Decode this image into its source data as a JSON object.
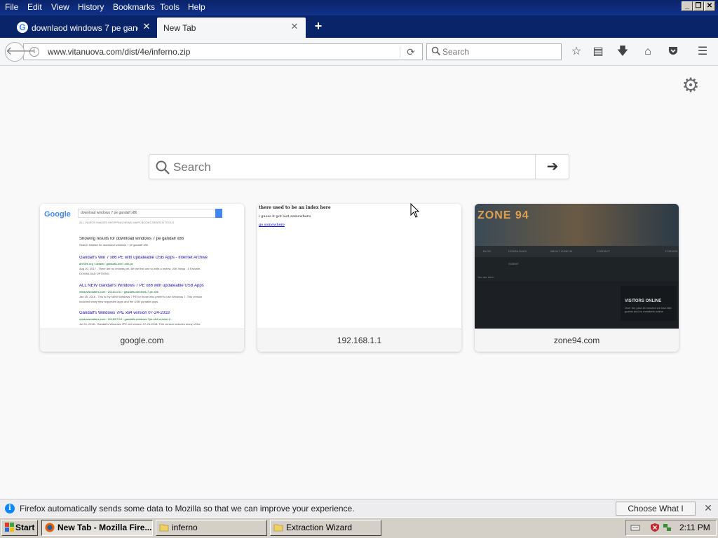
{
  "menubar": {
    "items": [
      "File",
      "Edit",
      "View",
      "History",
      "Bookmarks",
      "Tools",
      "Help"
    ]
  },
  "tabs": [
    {
      "title": "downlaod windows 7 pe gand...",
      "favicon": "google-g-icon",
      "active": false
    },
    {
      "title": "New Tab",
      "active": true
    }
  ],
  "navbar": {
    "url": "www.vitanuova.com/dist/4e/inferno.zip",
    "search_placeholder": "Search"
  },
  "newtab": {
    "search_placeholder": "Search",
    "tiles": [
      {
        "label": "google.com"
      },
      {
        "label": "192.168.1.1"
      },
      {
        "label": "zone94.com"
      }
    ]
  },
  "google_thumb": {
    "logo": "Google",
    "query": "download windows 7 pe gandalf x86",
    "tabs": "ALL    VIDEOS    IMAGES    SHOPPING    NEWS    MAPS    BOOKS    SEARCH TOOLS",
    "showing": "Showing results for download windows 7 pe gandalf x86",
    "search_instead": "Search instead for downlaod windows 7 pe gandalf x86",
    "r1_title": "Gandalf's Win 7 x86 PE with updateable USB Apps - Internet Archive",
    "r1_url": "archive.org › details › gandalfs-win7-x86-pe",
    "r1_desc": "Aug 20, 2017 - There are no reviews yet. Be the first one to write a review. 20K Views . 1 Favorite.",
    "r1_desc2": "DOWNLOAD OPTIONS",
    "r2_title": "ALL NEW Gandalf's Windows 7 PE x86 with updateable USB Apps",
    "r2_url": "windowsmatters.com › 2016/11/11 › gandalfs-windows-7-pe-x86",
    "r2_desc": "Jan 15, 2016 - This is my NEW Windows 7 PE for those who prefer to use Windows 7. This version",
    "r2_desc2": "included many new requested apps and the USB portable apps.",
    "r3_title": "Gandalf's Windows 7PE x64 version 07-24-2018",
    "r3_url": "windowsmatters.com › 2018/07/24 › gandalfs-windows-7pe-x64-version-2...",
    "r3_desc": "Jul 24, 2018 - Gandalf's Windows 7PE x64 version 07-24-2018. This version includes many of the"
  },
  "router_thumb": {
    "line1": "there used to be an index here",
    "line2": "i guess it got lost somewhere",
    "link": "go somewhere"
  },
  "zone_thumb": {
    "logo": "ZONE 94",
    "nav1": "BLOG",
    "nav2": "DOWNLOADS",
    "nav3": "ABOUT ZONE 94",
    "nav4": "CONTACT",
    "nav5": "FORUMS",
    "nav6": "SUBMIT",
    "you_are_here": "You are here:",
    "visitors": "VISITORS ONLINE",
    "visitors_sub": "Over the past 15 minutes we had 466 guests and no members online"
  },
  "notification": {
    "text": "Firefox automatically sends some data to Mozilla so that we can improve your experience.",
    "button": "Choose What I Share"
  },
  "taskbar": {
    "start": "Start",
    "tasks": [
      {
        "label": "New Tab - Mozilla Fire...",
        "active": true
      },
      {
        "label": "inferno",
        "active": false
      },
      {
        "label": "Extraction Wizard",
        "active": false
      }
    ],
    "clock": "2:11 PM"
  },
  "colors": {
    "titlebar": "#0a246a",
    "accent": "#0a84ff",
    "link": "#1a0dab",
    "taskbar": "#d4d0c8"
  }
}
